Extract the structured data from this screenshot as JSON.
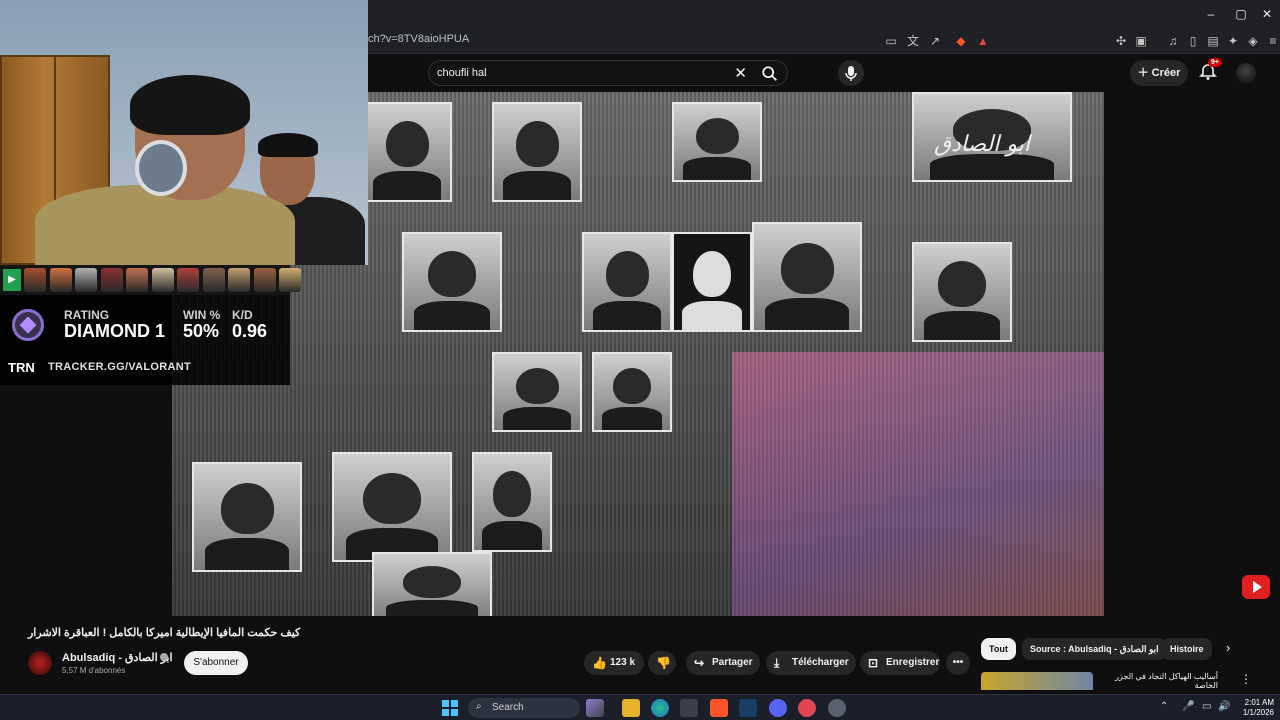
{
  "browser": {
    "url": "ch?v=8TV8aioHPUA",
    "window_controls": {
      "minimize": "–",
      "maximize": "▢",
      "close": "✕"
    }
  },
  "youtube": {
    "search_value": "choufli hal",
    "create_label": "Créer",
    "notification_count": "9+",
    "video_title": "كيف حكمت المافيا الإيطالية اميركا بالكامل ! العباقرة الاشرار",
    "channel_name": "Abulsadiq - ابو الصادق",
    "subscribers": "5,57 M d'abonnés",
    "subscribe_label": "S'abonner",
    "like_count": "123 k",
    "share_label": "Partager",
    "download_label": "Télécharger",
    "save_label": "Enregistrer",
    "more_label": "•••",
    "channel_logo_text": "ابو الصادق",
    "chips": {
      "all": "Tout",
      "source": "Source : Abulsadiq - ابو الصادق",
      "history": "Histoire"
    },
    "reco_title": "أساليب الهياكل التجاد في الجزر الخاصة"
  },
  "overlay": {
    "rating_label": "RATING",
    "rating_value": "DIAMOND 1",
    "win_label": "WIN %",
    "win_value": "50%",
    "kd_label": "K/D",
    "kd_value": "0.96",
    "trn_logo": "TRN",
    "trn_url": "TRACKER.GG/VALORANT",
    "agent_colors": [
      "#a85030",
      "#d07040",
      "#b0b0b0",
      "#8a3030",
      "#c07050",
      "#d0c0a0",
      "#b04040",
      "#806050",
      "#c0a070",
      "#9a6040",
      "#d0b070"
    ]
  },
  "taskbar": {
    "search_label": "Search",
    "time": "2:01 AM",
    "date": "1/1/2026"
  }
}
